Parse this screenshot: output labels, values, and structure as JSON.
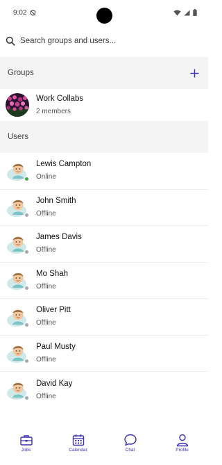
{
  "status_bar": {
    "time": "9:02"
  },
  "search": {
    "placeholder": "Search groups and users..."
  },
  "groups_section": {
    "title": "Groups",
    "items": [
      {
        "name": "Work Collabs",
        "subtitle": "2 members"
      }
    ]
  },
  "users_section": {
    "title": "Users",
    "items": [
      {
        "name": "Lewis Campton",
        "status": "Online"
      },
      {
        "name": "John Smith",
        "status": "Offline"
      },
      {
        "name": "James Davis",
        "status": "Offline"
      },
      {
        "name": "Mo Shah",
        "status": "Offline"
      },
      {
        "name": "Oliver Pitt",
        "status": "Offline"
      },
      {
        "name": "Paul Musty",
        "status": "Offline"
      },
      {
        "name": "David Kay",
        "status": "Offline"
      }
    ]
  },
  "tab_bar": {
    "tabs": [
      {
        "label": "Jobs",
        "icon": "briefcase-icon"
      },
      {
        "label": "Calendar",
        "icon": "calendar-icon"
      },
      {
        "label": "Chat",
        "icon": "chat-bubble-icon"
      },
      {
        "label": "Profile",
        "icon": "person-icon"
      }
    ]
  },
  "colors": {
    "accent": "#3b2fb2",
    "online": "#3fae49",
    "offline": "#a9a9a9",
    "section_background": "#f4f4f5"
  }
}
